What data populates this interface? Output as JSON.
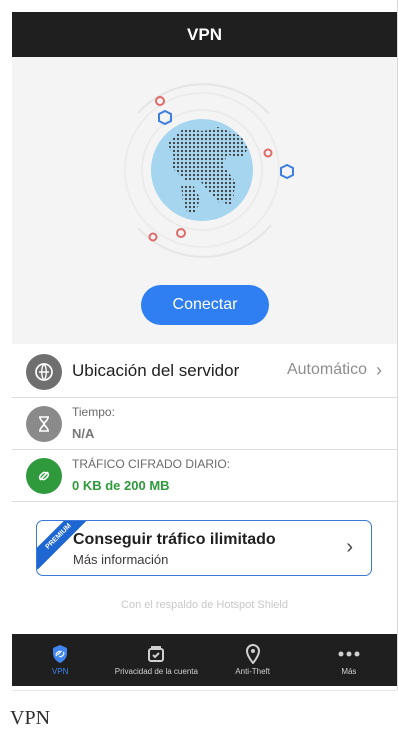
{
  "app": {
    "title": "VPN"
  },
  "hero": {
    "connect_label": "Conectar"
  },
  "rows": {
    "server_location_label": "Ubicación del servidor",
    "server_location_value": "Automático",
    "time_label": "Tiempo:",
    "time_value": "N/A",
    "traffic_label": "TRÁFICO CIFRADO DIARIO:",
    "traffic_value": "0 KB de 200 MB"
  },
  "promo": {
    "ribbon_label": "PREMIUM",
    "title": "Conseguir tráfico ilimitado",
    "subtitle": "Más información"
  },
  "footer": {
    "note": "Con el respaldo de Hotspot Shield"
  },
  "bottom_nav": {
    "items": [
      {
        "label": "VPN",
        "icon": "shield-icon",
        "active": true
      },
      {
        "label": "Privacidad de la cuenta",
        "icon": "privacy-icon",
        "active": false
      },
      {
        "label": "Anti-Theft",
        "icon": "location-pin-icon",
        "active": false
      },
      {
        "label": "Más",
        "icon": "more-icon",
        "active": false
      }
    ]
  },
  "caption": "VPN",
  "colors": {
    "accent": "#2f7ff2",
    "success": "#2e9a3b",
    "dark_bar": "#1f1f1f"
  }
}
